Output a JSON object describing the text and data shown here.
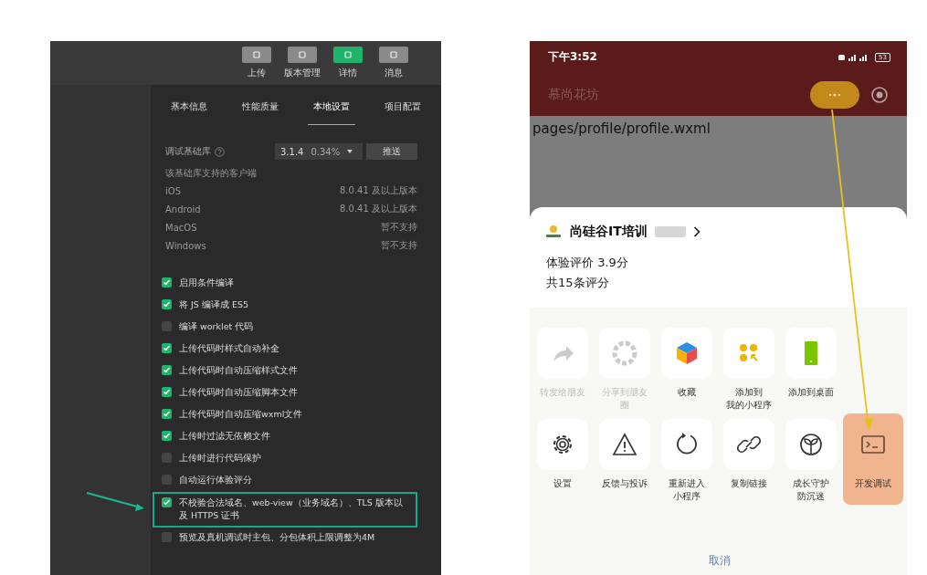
{
  "ide": {
    "toolbar": [
      {
        "label": "上传",
        "selected": false
      },
      {
        "label": "版本管理",
        "selected": false
      },
      {
        "label": "详情",
        "selected": true
      },
      {
        "label": "消息",
        "selected": false
      }
    ],
    "tabs": [
      {
        "label": "基本信息",
        "selected": false
      },
      {
        "label": "性能质量",
        "selected": false
      },
      {
        "label": "本地设置",
        "selected": true
      },
      {
        "label": "项目配置",
        "selected": false
      }
    ],
    "debug_lib": {
      "label": "调试基础库",
      "version": "3.1.4",
      "share": "0.34%",
      "button": "推送"
    },
    "support_note": "该基础库支持的客户端",
    "platforms": [
      {
        "name": "iOS",
        "value": "8.0.41 及以上版本"
      },
      {
        "name": "Android",
        "value": "8.0.41 及以上版本"
      },
      {
        "name": "MacOS",
        "value": "暂不支持"
      },
      {
        "name": "Windows",
        "value": "暂不支持"
      }
    ],
    "options": [
      {
        "label": "启用条件编译",
        "checked": true,
        "highlighted": false
      },
      {
        "label": "将 JS 编译成 ES5",
        "checked": true,
        "highlighted": false
      },
      {
        "label": "编译 worklet 代码",
        "checked": false,
        "highlighted": false
      },
      {
        "label": "上传代码时样式自动补全",
        "checked": true,
        "highlighted": false
      },
      {
        "label": "上传代码时自动压缩样式文件",
        "checked": true,
        "highlighted": false
      },
      {
        "label": "上传代码时自动压缩脚本文件",
        "checked": true,
        "highlighted": false
      },
      {
        "label": "上传代码时自动压缩wxml文件",
        "checked": true,
        "highlighted": false
      },
      {
        "label": "上传时过滤无依赖文件",
        "checked": true,
        "highlighted": false
      },
      {
        "label": "上传时进行代码保护",
        "checked": false,
        "highlighted": false
      },
      {
        "label": "自动运行体验评分",
        "checked": false,
        "highlighted": false
      },
      {
        "label": "不校验合法域名、web-view（业务域名）、TLS 版本以及 HTTPS 证书",
        "checked": true,
        "highlighted": true
      },
      {
        "label": "预览及真机调试时主包、分包体积上限调整为4M",
        "checked": false,
        "highlighted": false
      }
    ]
  },
  "phone": {
    "status_bar": {
      "time": "下午3:52",
      "battery": "53"
    },
    "nav_title": "慕尚花坊",
    "page_path": "pages/profile/profile.wxml",
    "sheet": {
      "app_name": "尚硅谷IT培训",
      "rating": "体验评价 3.9分",
      "rating_count": "共15条评分",
      "row_1": [
        {
          "lines": [
            "转发给朋友"
          ],
          "disabled": true,
          "highlighted": false
        },
        {
          "lines": [
            "分享到朋友",
            "圈"
          ],
          "disabled": true,
          "highlighted": false
        },
        {
          "lines": [
            "收藏"
          ],
          "disabled": false,
          "highlighted": false
        },
        {
          "lines": [
            "添加到",
            "我的小程序"
          ],
          "disabled": false,
          "highlighted": false
        },
        {
          "lines": [
            "添加到桌面"
          ],
          "disabled": false,
          "highlighted": false
        }
      ],
      "row_2": [
        {
          "lines": [
            "设置"
          ],
          "disabled": false,
          "highlighted": false
        },
        {
          "lines": [
            "反馈与投诉"
          ],
          "disabled": false,
          "highlighted": false
        },
        {
          "lines": [
            "重新进入",
            "小程序"
          ],
          "disabled": false,
          "highlighted": false
        },
        {
          "lines": [
            "复制链接"
          ],
          "disabled": false,
          "highlighted": false
        },
        {
          "lines": [
            "成长守护",
            "防沉迷"
          ],
          "disabled": false,
          "highlighted": false
        },
        {
          "lines": [
            "开发调试"
          ],
          "disabled": false,
          "highlighted": true
        }
      ],
      "cancel": "取消"
    }
  }
}
